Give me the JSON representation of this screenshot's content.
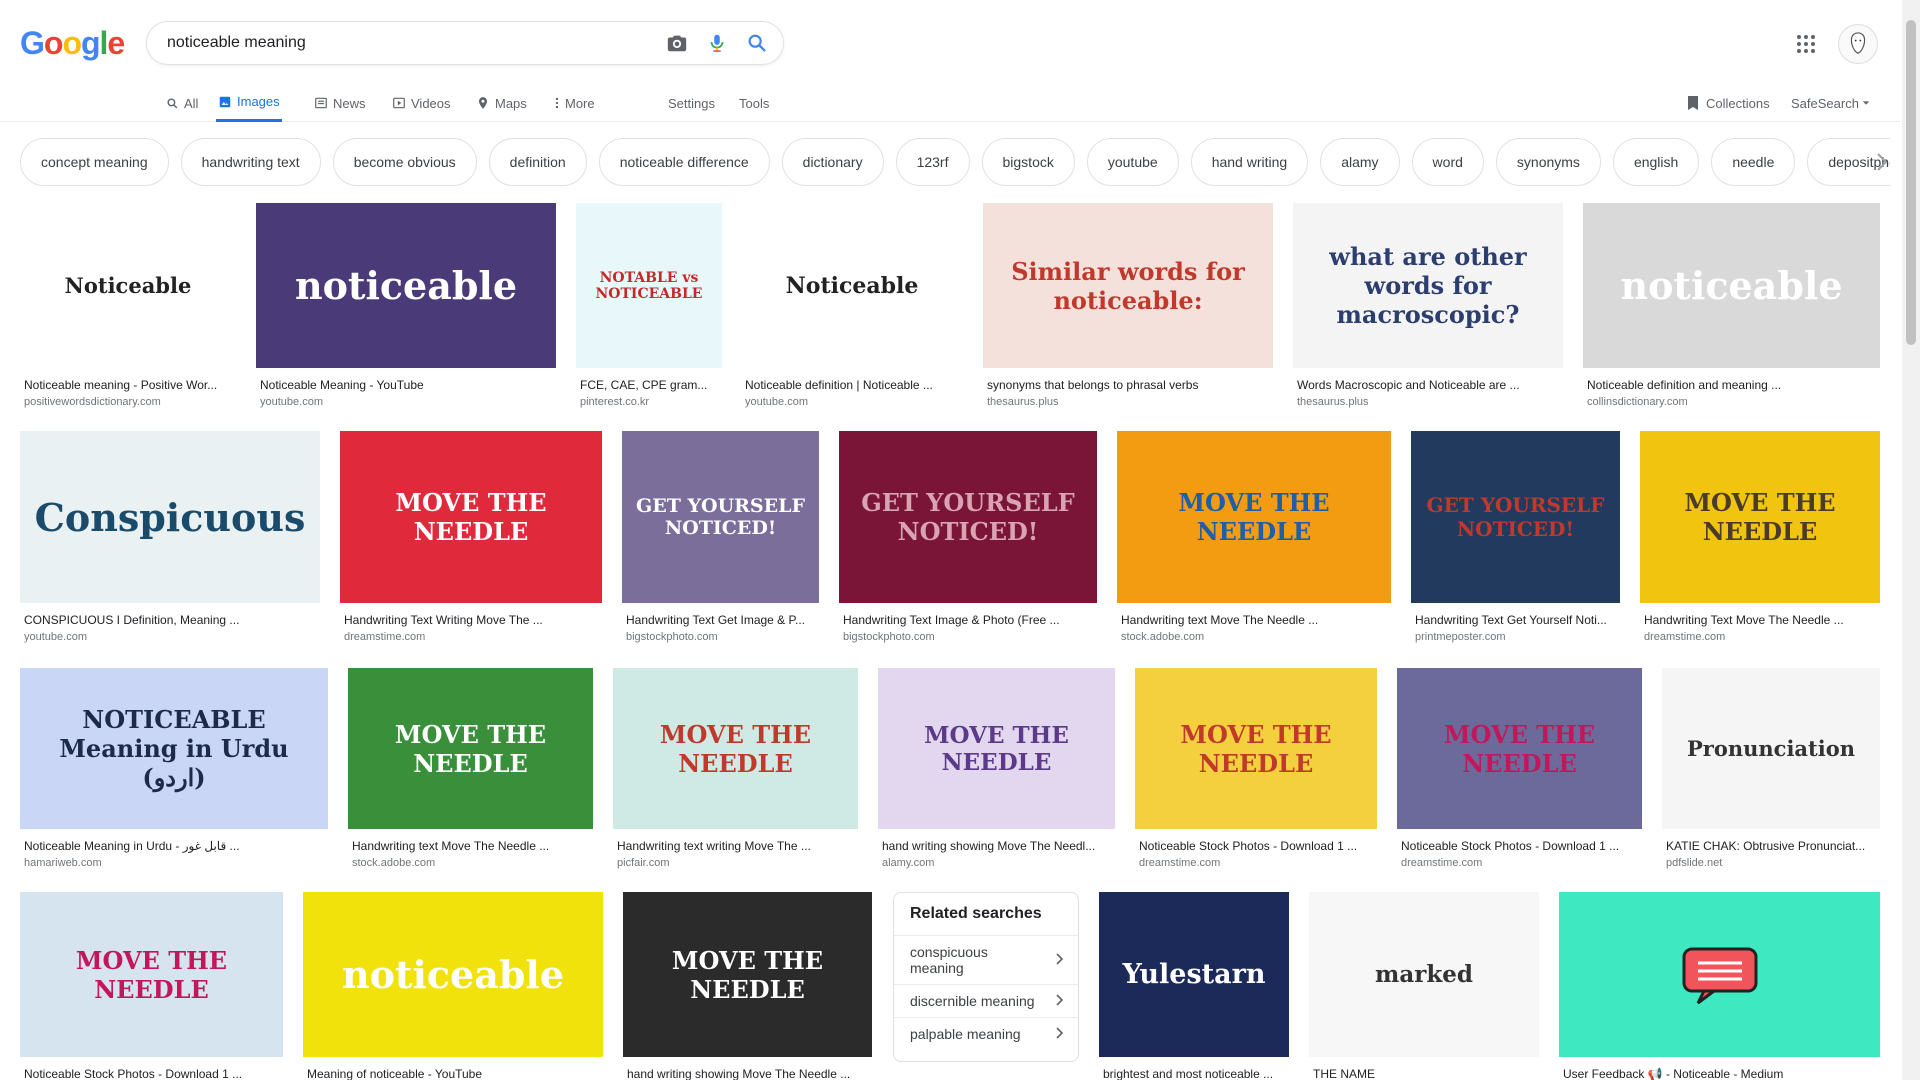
{
  "logo": [
    "G",
    "o",
    "o",
    "g",
    "l",
    "e"
  ],
  "logo_colors": [
    "#4285f4",
    "#ea4335",
    "#fbbc05",
    "#4285f4",
    "#34a853",
    "#ea4335"
  ],
  "search": {
    "value": "noticeable meaning",
    "camera_icon": "camera-icon",
    "mic_icon": "mic-icon",
    "search_icon": "search-icon"
  },
  "tabs": {
    "all": "All",
    "images": "Images",
    "news": "News",
    "videos": "Videos",
    "maps": "Maps",
    "more": "More",
    "settings": "Settings",
    "tools": "Tools",
    "collections": "Collections",
    "safesearch": "SafeSearch"
  },
  "chips": [
    "concept meaning",
    "handwriting text",
    "become obvious",
    "definition",
    "noticeable difference",
    "dictionary",
    "123rf",
    "bigstock",
    "youtube",
    "hand writing",
    "alamy",
    "word",
    "synonyms",
    "english",
    "needle",
    "depositphotos"
  ],
  "results": [
    {
      "caption": "Noticeable meaning - Positive Wor...",
      "source": "positivewordsdictionary.com",
      "thumb_text": "Noticeable",
      "bg": "#ffffff",
      "fg": "#222222"
    },
    {
      "caption": "Noticeable Meaning - YouTube",
      "source": "youtube.com",
      "thumb_text": "noticeable",
      "bg": "#4a3a78",
      "fg": "#ffffff"
    },
    {
      "caption": "FCE, CAE, CPE gram...",
      "source": "pinterest.co.kr",
      "thumb_text": "NOTABLE vs NOTICEABLE",
      "bg": "#e8f7fa",
      "fg": "#c62828"
    },
    {
      "caption": "Noticeable definition | Noticeable ...",
      "source": "youtube.com",
      "thumb_text": "Noticeable",
      "bg": "#ffffff",
      "fg": "#222222"
    },
    {
      "caption": "synonyms that belongs to phrasal verbs",
      "source": "thesaurus.plus",
      "thumb_text": "Similar words for noticeable:",
      "bg": "#f5e1dc",
      "fg": "#c0392b"
    },
    {
      "caption": "Words Macroscopic and Noticeable are ...",
      "source": "thesaurus.plus",
      "thumb_text": "what are other words for macroscopic?",
      "bg": "#f4f4f4",
      "fg": "#2c3e70"
    },
    {
      "caption": "Noticeable definition and meaning ...",
      "source": "collinsdictionary.com",
      "thumb_text": "noticeable",
      "bg": "#d9d9d9",
      "fg": "#ffffff"
    },
    {
      "caption": "CONSPICUOUS I Definition, Meaning ...",
      "source": "youtube.com",
      "thumb_text": "Conspicuous",
      "bg": "#e9f1f3",
      "fg": "#1b4b6b"
    },
    {
      "caption": "Handwriting Text Writing Move The ...",
      "source": "dreamstime.com",
      "thumb_text": "MOVE THE NEEDLE",
      "bg": "#e02a3c",
      "fg": "#ffffff"
    },
    {
      "caption": "Handwriting Text Get Image & P...",
      "source": "bigstockphoto.com",
      "thumb_text": "GET YOURSELF NOTICED!",
      "bg": "#7b6e9a",
      "fg": "#ffffff"
    },
    {
      "caption": "Handwriting Text Image & Photo (Free ...",
      "source": "bigstockphoto.com",
      "thumb_text": "GET YOURSELF NOTICED!",
      "bg": "#7a1538",
      "fg": "#d9a3b3"
    },
    {
      "caption": "Handwriting text Move The Needle ...",
      "source": "stock.adobe.com",
      "thumb_text": "MOVE THE NEEDLE",
      "bg": "#f39c12",
      "fg": "#1f5fa8"
    },
    {
      "caption": "Handwriting Text Get Yourself Noti...",
      "source": "printmeposter.com",
      "thumb_text": "GET YOURSELF NOTICED!",
      "bg": "#223a5e",
      "fg": "#c0392b"
    },
    {
      "caption": "Handwriting Text Move The Needle ...",
      "source": "dreamstime.com",
      "thumb_text": "MOVE THE NEEDLE",
      "bg": "#f1c40f",
      "fg": "#4a3b2a"
    },
    {
      "caption": "Noticeable Meaning in Urdu - قابل غور ...",
      "source": "hamariweb.com",
      "thumb_text": "NOTICEABLE  Meaning in Urdu (اردو)",
      "bg": "#c9d6f5",
      "fg": "#1c2b4a"
    },
    {
      "caption": "Handwriting text Move The Needle ...",
      "source": "stock.adobe.com",
      "thumb_text": "MOVE THE NEEDLE",
      "bg": "#3a8f3a",
      "fg": "#ffffff"
    },
    {
      "caption": "Handwriting text writing Move The ...",
      "source": "picfair.com",
      "thumb_text": "MOVE THE NEEDLE",
      "bg": "#cfe9e4",
      "fg": "#c0392b"
    },
    {
      "caption": "hand writing showing Move The Needl...",
      "source": "alamy.com",
      "thumb_text": "MOVE THE NEEDLE",
      "bg": "#e3d7f0",
      "fg": "#5b3a8a"
    },
    {
      "caption": "Noticeable Stock Photos - Download 1 ...",
      "source": "dreamstime.com",
      "thumb_text": "MOVE THE NEEDLE",
      "bg": "#f4d03f",
      "fg": "#c0392b"
    },
    {
      "caption": "Noticeable Stock Photos - Download 1 ...",
      "source": "dreamstime.com",
      "thumb_text": "MOVE THE NEEDLE",
      "bg": "#6c6a9a",
      "fg": "#c2185b"
    },
    {
      "caption": "KATIE CHAK: Obtrusive Pronunciat...",
      "source": "pdfslide.net",
      "thumb_text": "Pronunciation",
      "bg": "#f5f5f5",
      "fg": "#333333"
    },
    {
      "caption": "Noticeable Stock Photos - Download 1 ...",
      "source": "",
      "thumb_text": "MOVE THE NEEDLE",
      "bg": "#d6e4f0",
      "fg": "#c2185b"
    },
    {
      "caption": "Meaning of noticeable - YouTube",
      "source": "",
      "thumb_text": "noticeable",
      "bg": "#f1e20c",
      "fg": "#ffffff"
    },
    {
      "caption": "hand writing showing Move The Needle ...",
      "source": "",
      "thumb_text": "MOVE THE NEEDLE",
      "bg": "#2b2b2b",
      "fg": "#ffffff"
    },
    {
      "caption": "brightest and most noticeable ...",
      "source": "",
      "thumb_text": "Yulestarn",
      "bg": "#1c2a5a",
      "fg": "#ffffff"
    },
    {
      "caption": "THE NAME",
      "source": "",
      "thumb_text": "marked",
      "bg": "#f7f7f7",
      "fg": "#333333"
    },
    {
      "caption": "User Feedback 📢 - Noticeable - Medium",
      "source": "",
      "thumb_text": "",
      "bg": "#3ee8c0",
      "fg": "#ffffff"
    }
  ],
  "related": {
    "title": "Related searches",
    "items": [
      "conspicuous meaning",
      "discernible meaning",
      "palpable meaning"
    ]
  }
}
